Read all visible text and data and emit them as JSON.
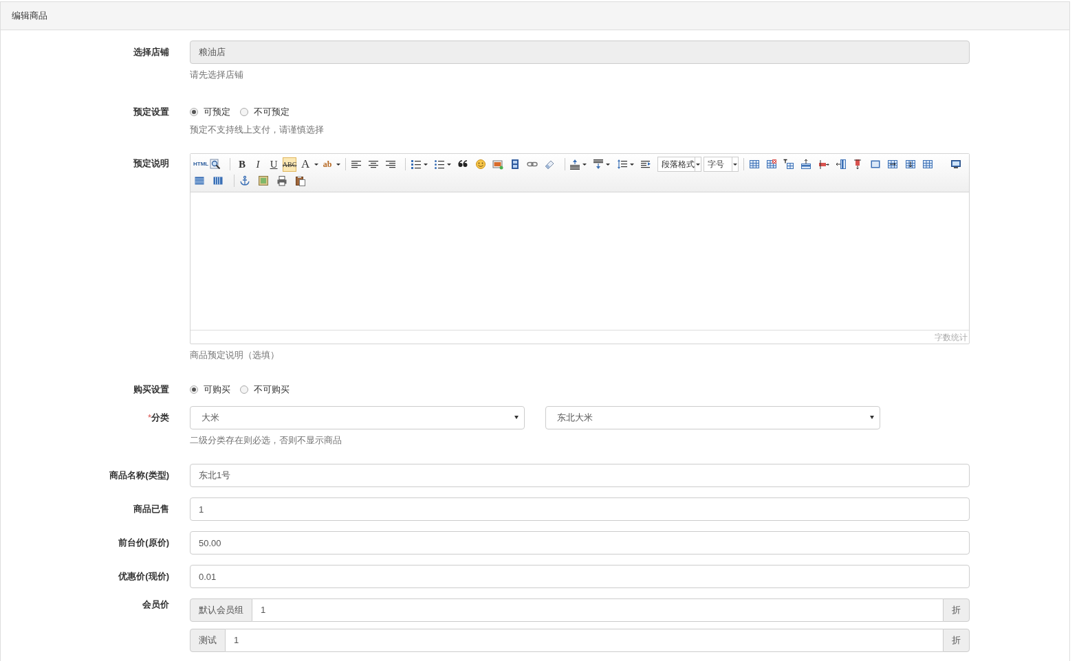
{
  "panel": {
    "title": "编辑商品"
  },
  "form": [
    {
      "kind": "select",
      "label": "选择店铺",
      "value": "粮油店",
      "disabled": true,
      "help": "请先选择店铺"
    },
    {
      "kind": "radio",
      "label": "预定设置",
      "options": [
        {
          "label": "可预定",
          "selected": true
        },
        {
          "label": "不可预定",
          "selected": false
        }
      ],
      "help": "预定不支持线上支付，请谨慎选择"
    },
    {
      "kind": "editor",
      "label": "预定说明",
      "toolbar": [
        [
          {
            "kind": "glyph",
            "text": "HTML",
            "active": false
          },
          {
            "kind": "icon"
          },
          {
            "kind": "sep"
          },
          {
            "kind": "glyph",
            "text": "B",
            "active": false
          },
          {
            "kind": "glyph",
            "text": "I",
            "active": false
          },
          {
            "kind": "glyph",
            "text": "U",
            "active": false
          },
          {
            "kind": "glyph",
            "text": "ABC",
            "active": true
          },
          {
            "kind": "glyph_menu",
            "text": "A",
            "active": false
          },
          {
            "kind": "glyph_menu",
            "text": "ab",
            "active": false
          },
          {
            "kind": "sep"
          },
          {
            "kind": "icon"
          },
          {
            "kind": "icon"
          },
          {
            "kind": "icon"
          },
          {
            "kind": "sep"
          },
          {
            "kind": "icon_menu"
          },
          {
            "kind": "icon_menu"
          },
          {
            "kind": "icon"
          },
          {
            "kind": "icon"
          },
          {
            "kind": "icon"
          },
          {
            "kind": "icon"
          },
          {
            "kind": "icon"
          },
          {
            "kind": "icon"
          },
          {
            "kind": "sep"
          },
          {
            "kind": "icon_menu"
          },
          {
            "kind": "icon_menu"
          },
          {
            "kind": "icon_menu"
          },
          {
            "kind": "icon"
          },
          {
            "kind": "select",
            "text": "段落格式"
          },
          {
            "kind": "select",
            "text": "字号"
          },
          {
            "kind": "sep"
          },
          {
            "kind": "icon"
          },
          {
            "kind": "icon"
          },
          {
            "kind": "icon"
          },
          {
            "kind": "icon"
          },
          {
            "kind": "icon"
          },
          {
            "kind": "icon"
          },
          {
            "kind": "icon"
          },
          {
            "kind": "icon"
          },
          {
            "kind": "icon"
          },
          {
            "kind": "icon"
          },
          {
            "kind": "icon"
          },
          {
            "kind": "gap"
          },
          {
            "kind": "icon"
          }
        ],
        [
          {
            "kind": "icon"
          },
          {
            "kind": "icon"
          },
          {
            "kind": "sep"
          },
          {
            "kind": "icon"
          },
          {
            "kind": "icon"
          },
          {
            "kind": "icon"
          },
          {
            "kind": "icon"
          }
        ]
      ],
      "word_count": "字数统计",
      "help": "商品预定说明（选填）"
    },
    {
      "kind": "radio",
      "label": "购买设置",
      "options": [
        {
          "label": "可购买",
          "selected": true
        },
        {
          "label": "不可购买",
          "selected": false
        }
      ]
    },
    {
      "kind": "category",
      "mark": "*",
      "label": "分类",
      "selects": [
        {
          "value": "大米"
        },
        {
          "value": "东北大米"
        }
      ],
      "help": "二级分类存在则必选，否则不显示商品"
    },
    {
      "kind": "text",
      "label": "商品名称(类型)",
      "value": "东北1号"
    },
    {
      "kind": "text",
      "label": "商品已售",
      "value": "1"
    },
    {
      "kind": "text",
      "label": "前台价(原价)",
      "value": "50.00"
    },
    {
      "kind": "text",
      "label": "优惠价(现价)",
      "value": "0.01"
    },
    {
      "kind": "member_price",
      "label": "会员价",
      "groups": [
        {
          "name": "默认会员组",
          "value": "1",
          "unit": "折"
        },
        {
          "name": "测试",
          "value": "1",
          "unit": "折"
        }
      ]
    }
  ]
}
